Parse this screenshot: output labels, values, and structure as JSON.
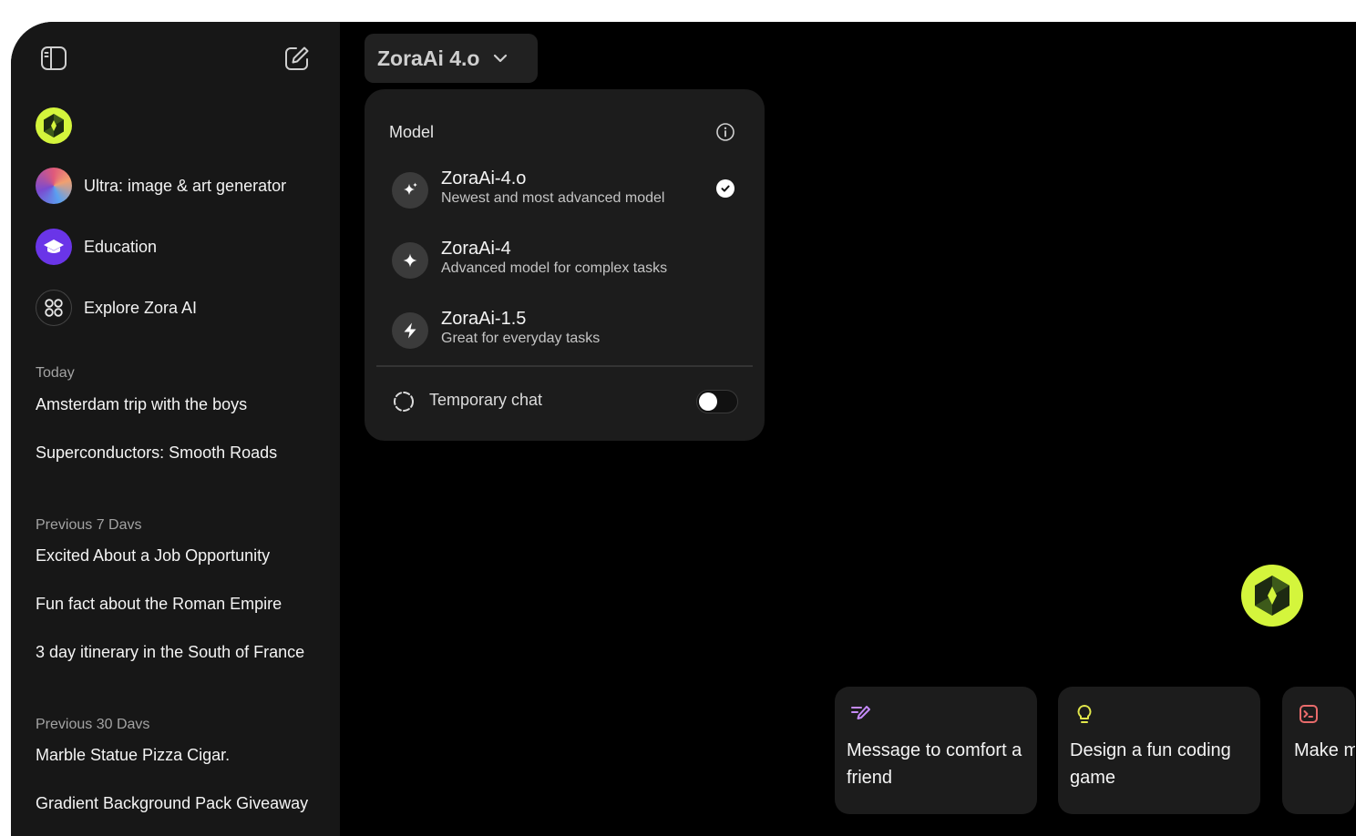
{
  "sidebar": {
    "nav": [
      {
        "label": "Ultra: image & art generator",
        "icon": "art-generator-icon"
      },
      {
        "label": "Education",
        "icon": "graduation-cap-icon"
      },
      {
        "label": "Explore Zora AI",
        "icon": "grid-icon"
      }
    ],
    "sections": [
      {
        "label": "Today",
        "items": [
          "Amsterdam trip with the boys",
          "Superconductors: Smooth Roads"
        ]
      },
      {
        "label": "Previous 7 Davs",
        "items": [
          "Excited About a Job Opportunity",
          "Fun fact about the Roman Empire",
          "3 day itinerary in the South of France"
        ]
      },
      {
        "label": "Previous 30 Davs",
        "items": [
          "Marble Statue Pizza Cigar.",
          "Gradient Background Pack Giveaway"
        ]
      }
    ]
  },
  "model_selector": {
    "label": "ZoraAi 4.o",
    "dropdown_title": "Model",
    "options": [
      {
        "name": "ZoraAi-4.o",
        "desc": "Newest and most advanced model",
        "icon": "sparkles-icon",
        "selected": true
      },
      {
        "name": "ZoraAi-4",
        "desc": "Advanced model for complex tasks",
        "icon": "sparkle-icon",
        "selected": false
      },
      {
        "name": "ZoraAi-1.5",
        "desc": "Great for everyday tasks",
        "icon": "lightning-icon",
        "selected": false
      }
    ],
    "temporary_chat": {
      "label": "Temporary chat",
      "enabled": false
    }
  },
  "suggestions": [
    {
      "text": "Message to comfort a friend",
      "icon": "pen-lines-icon",
      "color": "#c58af9"
    },
    {
      "text": "Design a fun coding game",
      "icon": "lightbulb-icon",
      "color": "#e2e84b"
    },
    {
      "text": "Make me a webpage",
      "icon": "terminal-icon",
      "color": "#e86b6b"
    }
  ],
  "colors": {
    "accent": "#d4f53c",
    "background": "#000000",
    "sidebar": "#171717",
    "panel": "#1c1c1c"
  }
}
